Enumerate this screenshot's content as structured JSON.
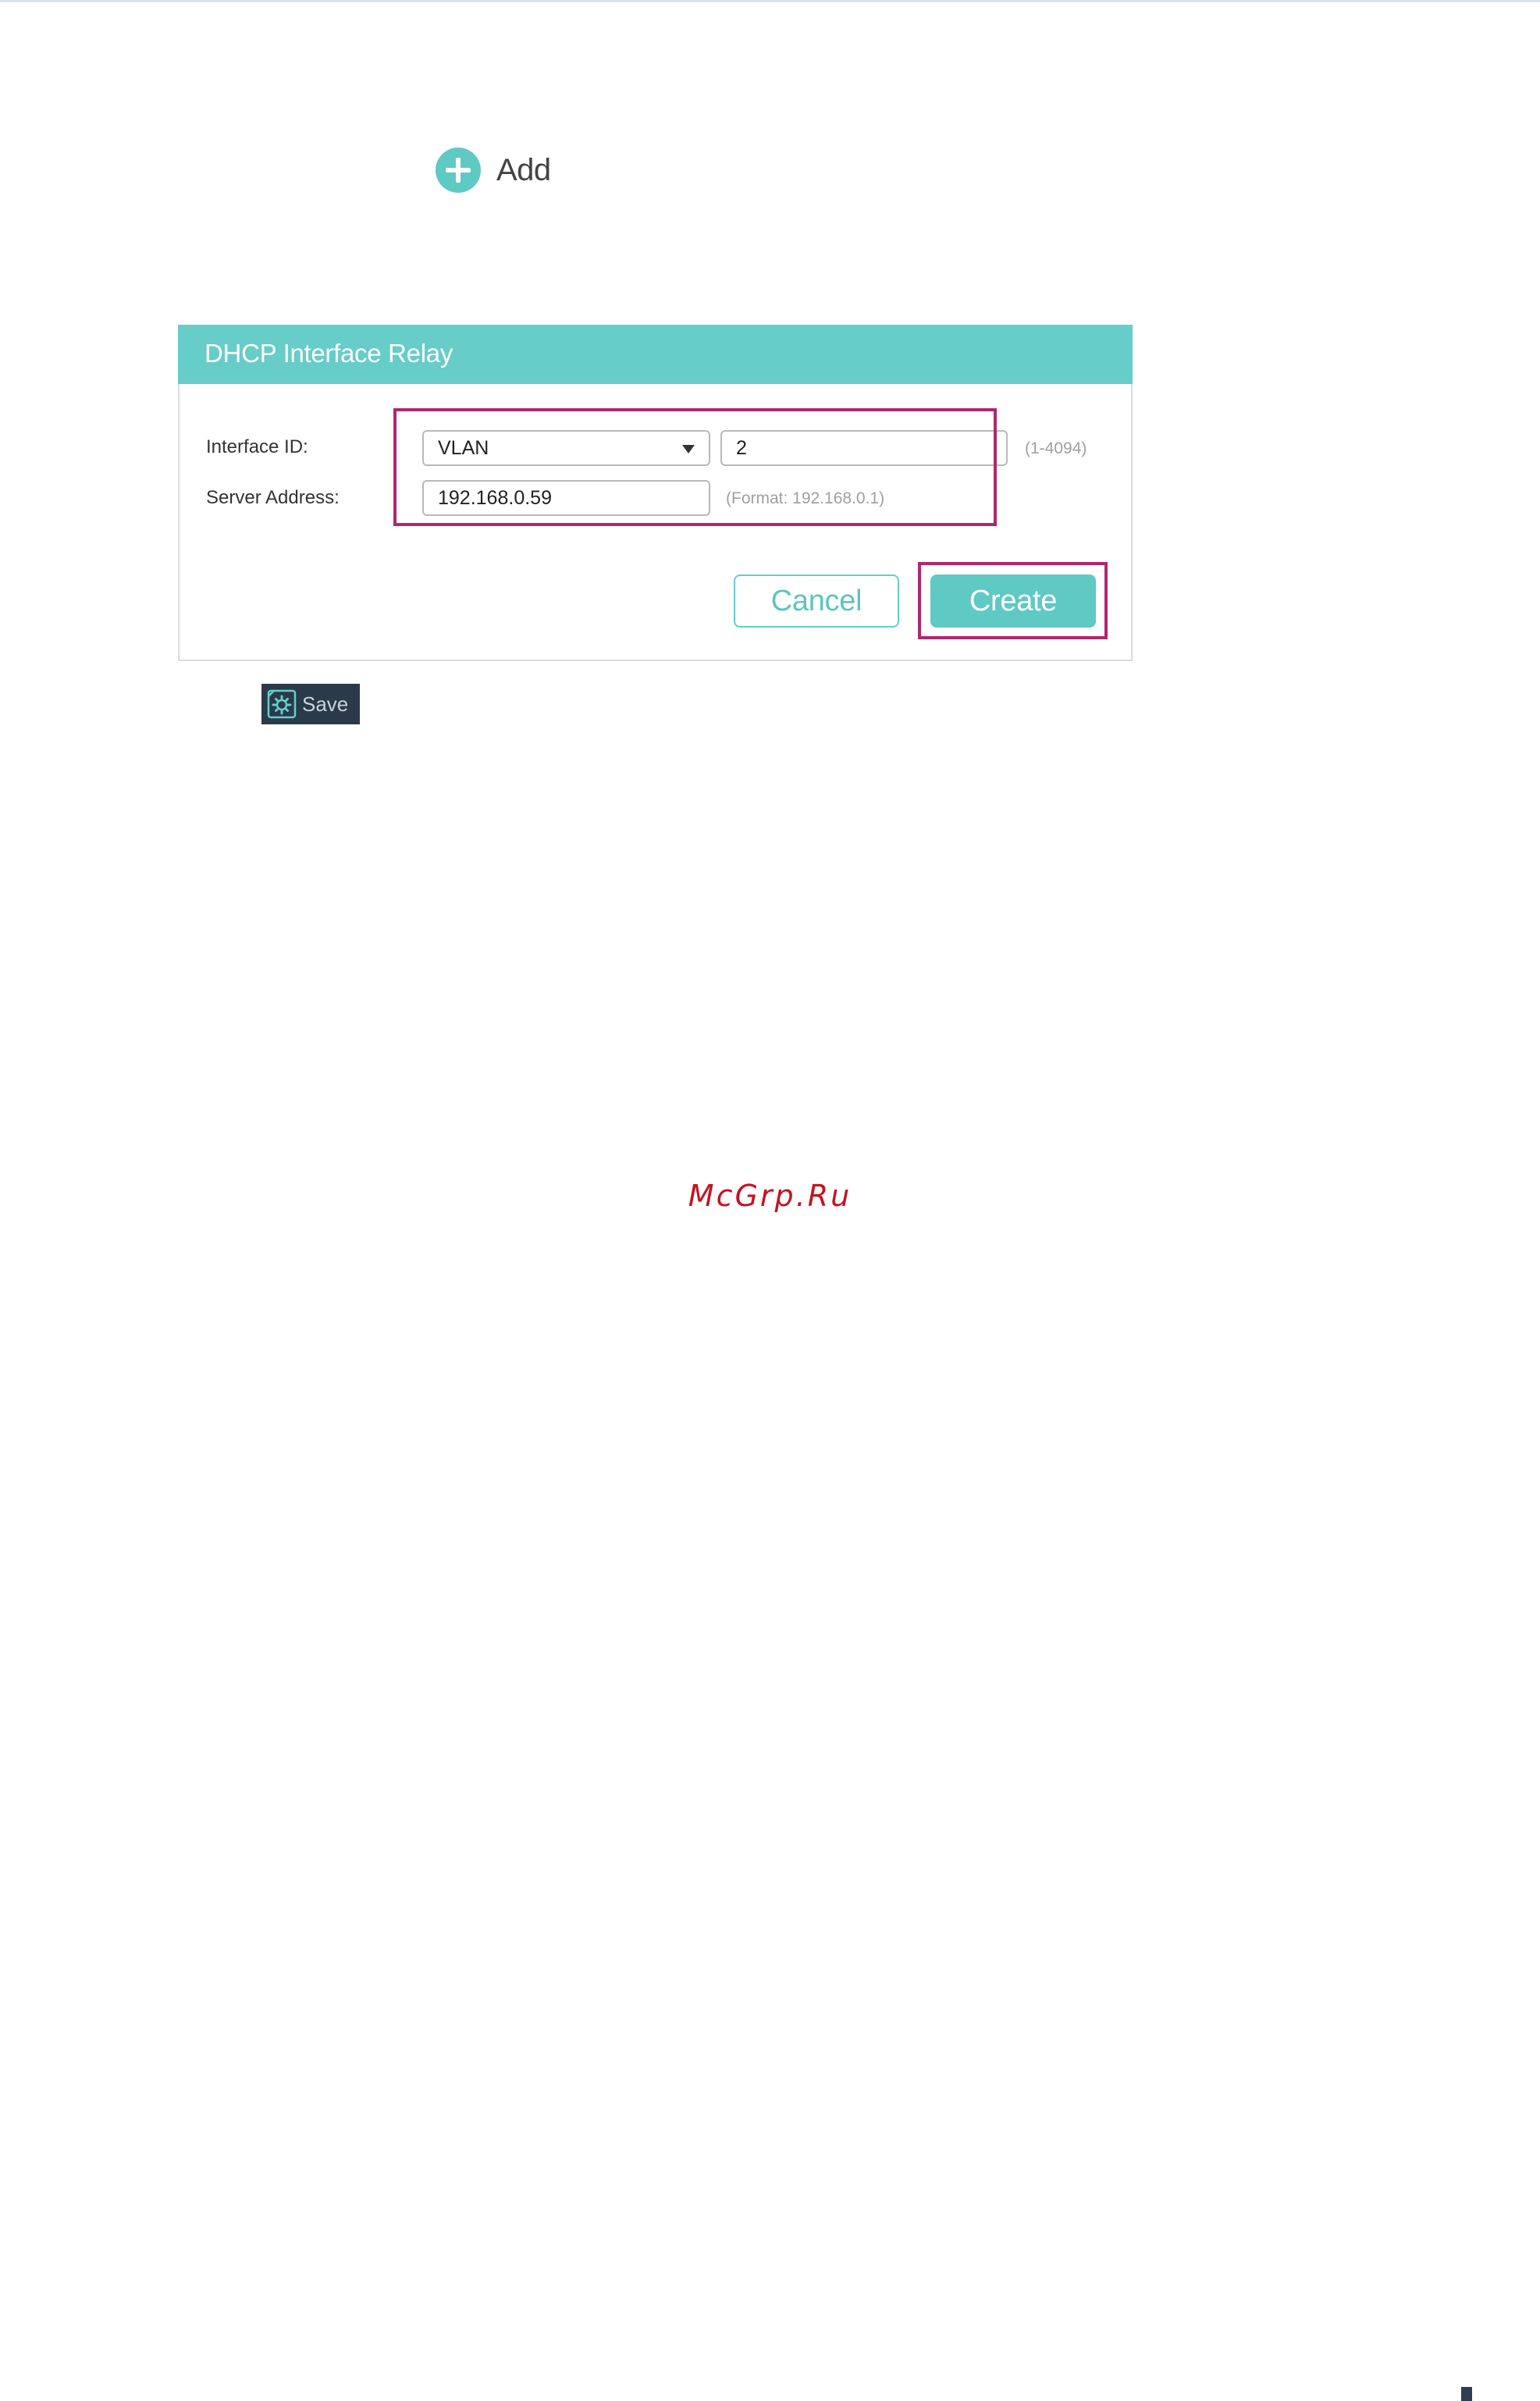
{
  "add_button": {
    "label": "Add",
    "icon": "plus-circle-icon"
  },
  "dialog": {
    "title": "DHCP Interface Relay",
    "interface_id": {
      "label": "Interface ID:",
      "type_value": "VLAN",
      "id_value": "2",
      "range_hint": "(1-4094)"
    },
    "server_address": {
      "label": "Server Address:",
      "value": "192.168.0.59",
      "format_hint": "(Format: 192.168.0.1)"
    },
    "cancel_label": "Cancel",
    "create_label": "Create"
  },
  "save_button": {
    "label": "Save",
    "icon": "gear-save-icon"
  },
  "watermark": "McGrp.Ru",
  "colors": {
    "accent": "#66cdc8",
    "highlight": "#b0266f",
    "save_bg": "#2a3a4a",
    "watermark": "#c4141f"
  }
}
